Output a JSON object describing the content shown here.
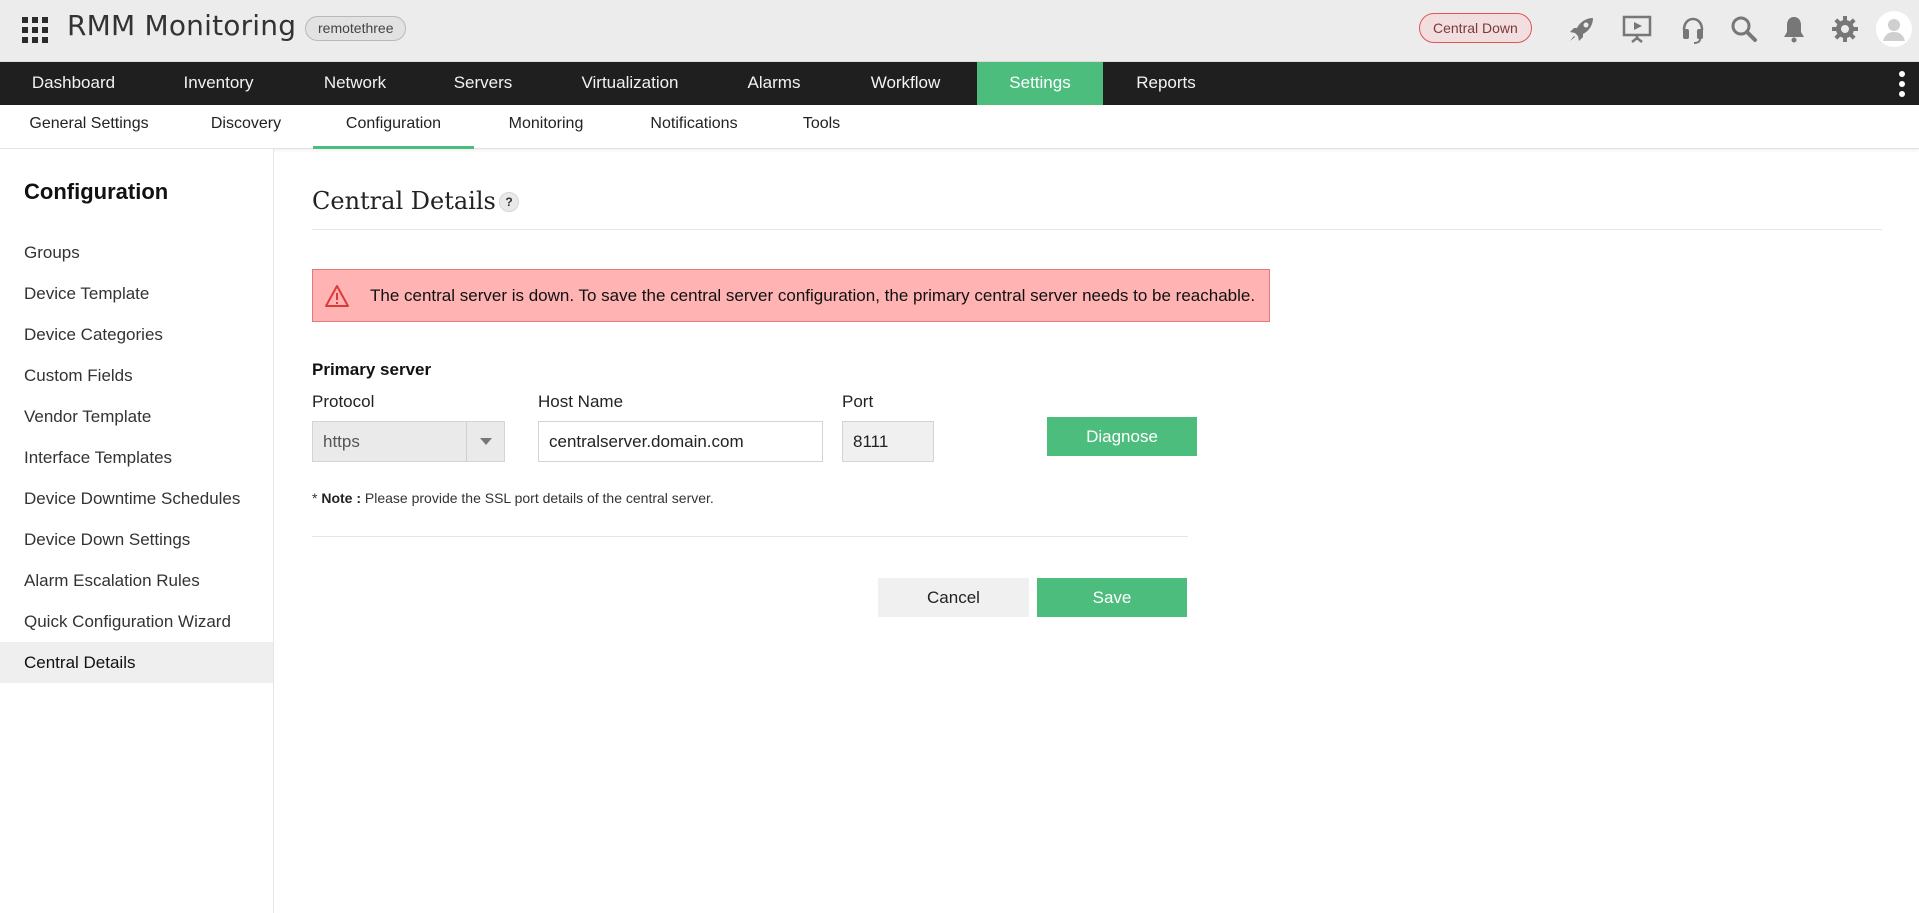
{
  "header": {
    "app_title": "RMM Monitoring",
    "tenant": "remotethree",
    "status_badge": "Central Down",
    "icons": [
      "apps-grid-icon",
      "rocket-icon",
      "presentation-icon",
      "headset-icon",
      "search-icon",
      "bell-icon",
      "gear-icon",
      "user-avatar-icon"
    ]
  },
  "main_nav": {
    "items": [
      {
        "label": "Dashboard"
      },
      {
        "label": "Inventory"
      },
      {
        "label": "Network"
      },
      {
        "label": "Servers"
      },
      {
        "label": "Virtualization"
      },
      {
        "label": "Alarms"
      },
      {
        "label": "Workflow"
      },
      {
        "label": "Settings"
      },
      {
        "label": "Reports"
      }
    ],
    "active": "Settings"
  },
  "sub_nav": {
    "items": [
      {
        "label": "General Settings"
      },
      {
        "label": "Discovery"
      },
      {
        "label": "Configuration"
      },
      {
        "label": "Monitoring"
      },
      {
        "label": "Notifications"
      },
      {
        "label": "Tools"
      }
    ],
    "active": "Configuration"
  },
  "sidebar": {
    "title": "Configuration",
    "items": [
      {
        "label": "Groups"
      },
      {
        "label": "Device Template"
      },
      {
        "label": "Device Categories"
      },
      {
        "label": "Custom Fields"
      },
      {
        "label": "Vendor Template"
      },
      {
        "label": "Interface Templates"
      },
      {
        "label": "Device Downtime Schedules"
      },
      {
        "label": "Device Down Settings"
      },
      {
        "label": "Alarm Escalation Rules"
      },
      {
        "label": "Quick Configuration Wizard"
      },
      {
        "label": "Central Details"
      }
    ],
    "active": "Central Details"
  },
  "main": {
    "title": "Central Details",
    "help": "?",
    "alert": "The central server is down. To save the central server configuration, the primary central server needs to be reachable.",
    "section_label": "Primary server",
    "protocol": {
      "label": "Protocol",
      "value": "https"
    },
    "host": {
      "label": "Host Name",
      "value": "centralserver.domain.com"
    },
    "port": {
      "label": "Port",
      "value": "8111"
    },
    "diagnose_label": "Diagnose",
    "note": {
      "asterisk": "*",
      "label": "Note :",
      "text": "Please provide the SSL port details of the central server."
    },
    "cancel_label": "Cancel",
    "save_label": "Save"
  },
  "colors": {
    "accent": "#4cbd7d",
    "nav_bg": "#1f1f1f",
    "alert_bg": "#ffb3b3",
    "alert_border": "#e27a7a",
    "status_badge_border": "#e05555"
  }
}
